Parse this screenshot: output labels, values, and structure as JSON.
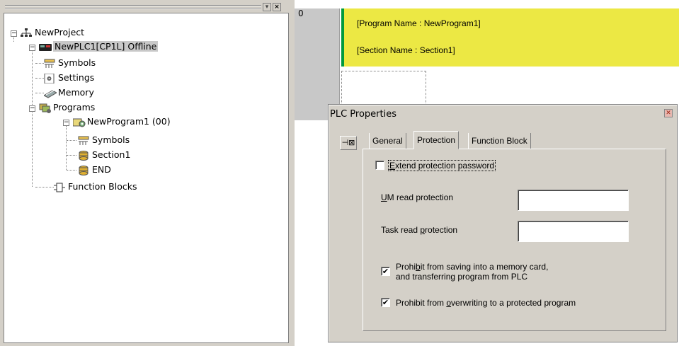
{
  "tree": {
    "project": "NewProject",
    "plc": "NewPLC1[CP1L] Offline",
    "symbols": "Symbols",
    "settings": "Settings",
    "memory": "Memory",
    "programs": "Programs",
    "program": "NewProgram1 (00)",
    "prog_symbols": "Symbols",
    "section": "Section1",
    "end": "END",
    "function_blocks": "Function Blocks"
  },
  "ladder": {
    "rung_number": "0",
    "program_name": "[Program Name : NewProgram1]",
    "section_name": "[Section Name : Section1]"
  },
  "dialog": {
    "title": "PLC Properties",
    "tabs": [
      "General",
      "Protection",
      "Function Block"
    ],
    "active_tab": "Protection",
    "extend_password": {
      "pre": "",
      "key": "E",
      "post": "xtend protection password",
      "checked": false
    },
    "um_read": {
      "pre": "",
      "key": "U",
      "post": "M read protection",
      "value": ""
    },
    "task_read": {
      "pre": "Task read ",
      "key": "p",
      "post": "rotection",
      "value": ""
    },
    "prohibit_saving": {
      "pre": "Prohi",
      "key": "b",
      "post": "it from saving into a memory card,",
      "line2": "and transferring program from PLC",
      "checked": true
    },
    "prohibit_overwrite": {
      "pre": "Prohibit from ",
      "key": "o",
      "post": "verwriting to a protected program",
      "checked": true
    }
  },
  "colors": {
    "comment_bg": "#ece844",
    "rail": "#009a3e"
  }
}
